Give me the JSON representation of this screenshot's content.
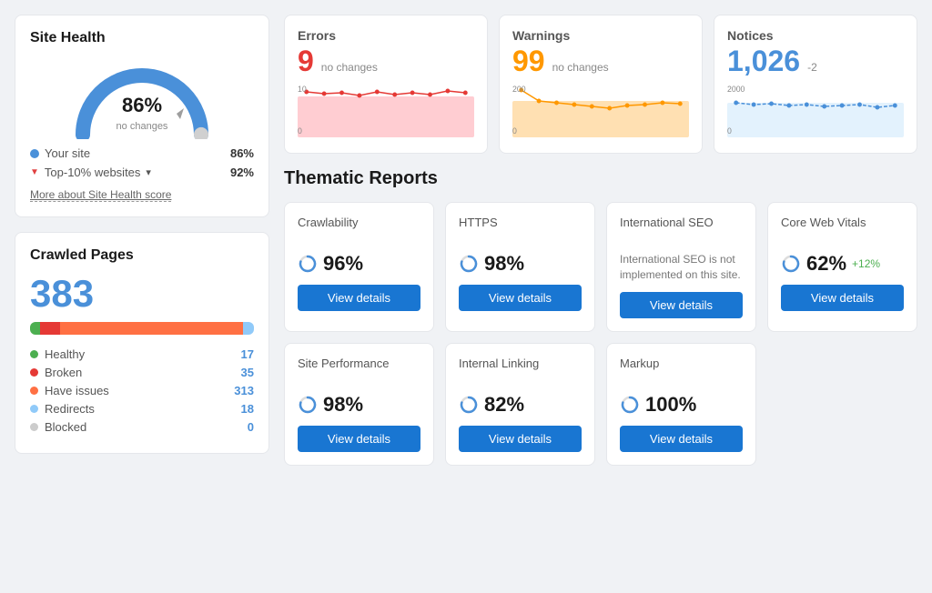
{
  "site_health": {
    "title": "Site Health",
    "percent": "86%",
    "sub": "no changes",
    "your_site_label": "Your site",
    "your_site_val": "86%",
    "top10_label": "Top-10% websites",
    "top10_val": "92%",
    "more_link": "More about Site Health score"
  },
  "crawled_pages": {
    "title": "Crawled Pages",
    "count": "383",
    "stats": [
      {
        "label": "Healthy",
        "val": "17",
        "color": "#4caf50"
      },
      {
        "label": "Broken",
        "val": "35",
        "color": "#e53935"
      },
      {
        "label": "Have issues",
        "val": "313",
        "color": "#ff7043"
      },
      {
        "label": "Redirects",
        "val": "18",
        "color": "#90caf9"
      },
      {
        "label": "Blocked",
        "val": "0",
        "color": "#cccccc"
      }
    ],
    "bar": [
      {
        "pct": 4.4,
        "color": "#4caf50"
      },
      {
        "pct": 9.1,
        "color": "#e53935"
      },
      {
        "pct": 81.7,
        "color": "#ff7043"
      },
      {
        "pct": 4.7,
        "color": "#90caf9"
      }
    ]
  },
  "errors": {
    "title": "Errors",
    "value": "9",
    "sub": "no changes",
    "color": "#e53935",
    "chart_max": "10",
    "chart_zero": "0",
    "chart_color": "#ffcdd2",
    "line_color": "#e53935"
  },
  "warnings": {
    "title": "Warnings",
    "value": "99",
    "sub": "no changes",
    "color": "#ff9800",
    "chart_max": "200",
    "chart_zero": "0",
    "chart_color": "#ffe0b2",
    "line_color": "#ff9800"
  },
  "notices": {
    "title": "Notices",
    "value": "1,026",
    "change": "-2",
    "color": "#4a90d9",
    "chart_max": "2000",
    "chart_zero": "0",
    "chart_color": "#e3f2fd",
    "line_color": "#4a90d9"
  },
  "thematic_reports": {
    "title": "Thematic Reports",
    "view_btn": "View details",
    "top_row": [
      {
        "name": "Crawlability",
        "score": "96%",
        "change": "",
        "has_desc": false,
        "desc": ""
      },
      {
        "name": "HTTPS",
        "score": "98%",
        "change": "",
        "has_desc": false,
        "desc": ""
      },
      {
        "name": "International SEO",
        "score": "",
        "change": "",
        "has_desc": true,
        "desc": "International SEO is not implemented on this site."
      },
      {
        "name": "Core Web Vitals",
        "score": "62%",
        "change": "+12%",
        "has_desc": false,
        "desc": ""
      }
    ],
    "bottom_row": [
      {
        "name": "Site Performance",
        "score": "98%",
        "change": "",
        "has_desc": false,
        "desc": ""
      },
      {
        "name": "Internal Linking",
        "score": "82%",
        "change": "",
        "has_desc": false,
        "desc": ""
      },
      {
        "name": "Markup",
        "score": "100%",
        "change": "",
        "has_desc": false,
        "desc": ""
      }
    ]
  }
}
